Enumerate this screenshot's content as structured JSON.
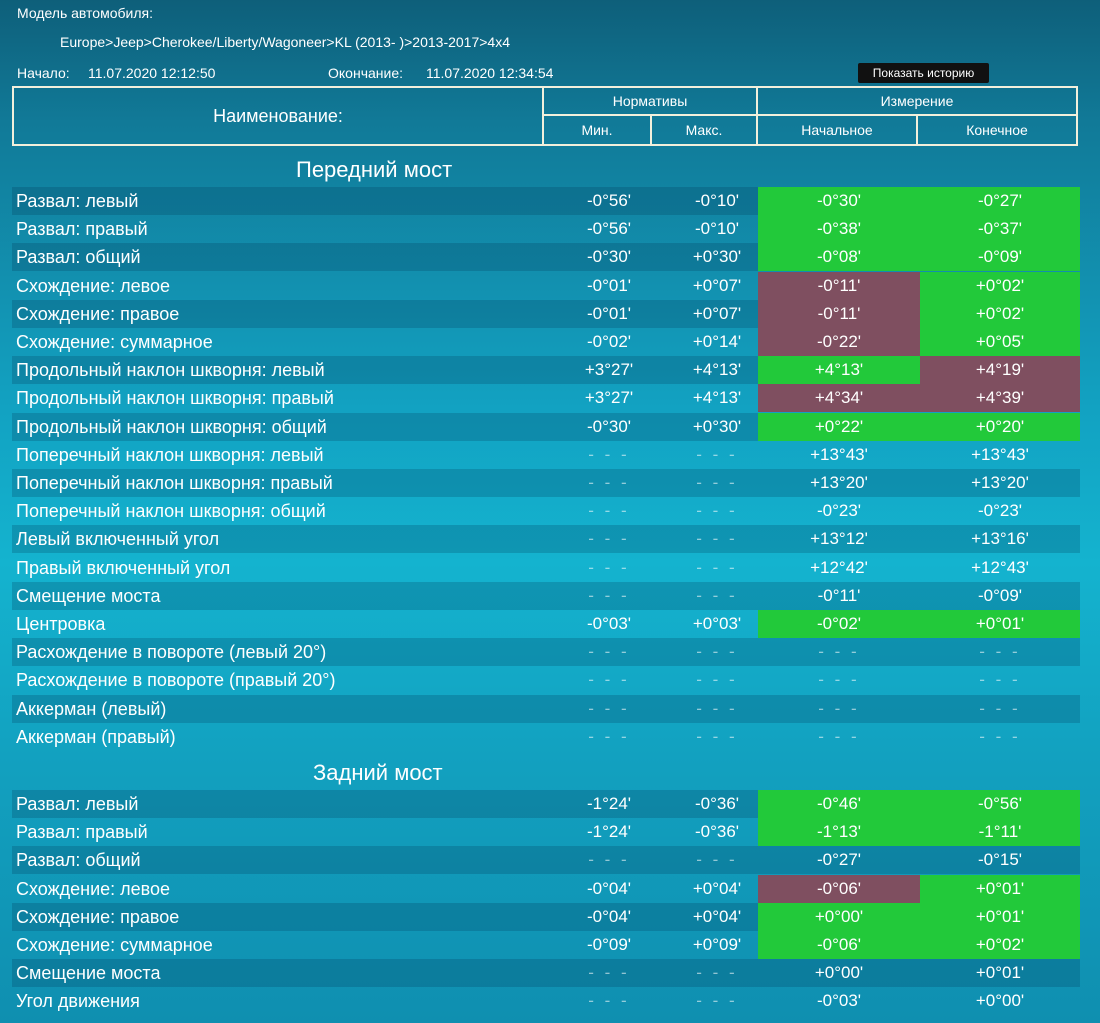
{
  "header": {
    "model_label": "Модель автомобиля:",
    "model_path": "Europe>Jeep>Cherokee/Liberty/Wagoneer>KL (2013- )>2013-2017>4x4",
    "start_label": "Начало:",
    "start_value": "11.07.2020 12:12:50",
    "end_label": "Окончание:",
    "end_value": "11.07.2020 12:34:54",
    "history_button": "Показать историю"
  },
  "table_header": {
    "name": "Наименование:",
    "norms": "Нормативы",
    "measure": "Измерение",
    "min": "Мин.",
    "max": "Макс.",
    "initial": "Начальное",
    "final": "Конечное"
  },
  "colors": {
    "green": "#22c93a",
    "red": "#7f4f60",
    "background": "#12a2c2"
  },
  "front": {
    "title": "Передний мост",
    "rows": [
      {
        "name": "Развал: левый",
        "min": "-0°56'",
        "max": "-0°10'",
        "initial": "-0°30'",
        "final": "-0°27'",
        "ini_status": "ok",
        "fin_status": "ok"
      },
      {
        "name": "Развал: правый",
        "min": "-0°56'",
        "max": "-0°10'",
        "initial": "-0°38'",
        "final": "-0°37'",
        "ini_status": "ok",
        "fin_status": "ok"
      },
      {
        "name": "Развал: общий",
        "min": "-0°30'",
        "max": "+0°30'",
        "initial": "-0°08'",
        "final": "-0°09'",
        "ini_status": "ok",
        "fin_status": "ok"
      },
      {
        "name": "Схождение: левое",
        "min": "-0°01'",
        "max": "+0°07'",
        "initial": "-0°11'",
        "final": "+0°02'",
        "ini_status": "bad",
        "fin_status": "ok"
      },
      {
        "name": "Схождение: правое",
        "min": "-0°01'",
        "max": "+0°07'",
        "initial": "-0°11'",
        "final": "+0°02'",
        "ini_status": "bad",
        "fin_status": "ok"
      },
      {
        "name": "Схождение: суммарное",
        "min": "-0°02'",
        "max": "+0°14'",
        "initial": "-0°22'",
        "final": "+0°05'",
        "ini_status": "bad",
        "fin_status": "ok"
      },
      {
        "name": "Продольный наклон шкворня: левый",
        "min": "+3°27'",
        "max": "+4°13'",
        "initial": "+4°13'",
        "final": "+4°19'",
        "ini_status": "ok",
        "fin_status": "bad"
      },
      {
        "name": "Продольный наклон шкворня: правый",
        "min": "+3°27'",
        "max": "+4°13'",
        "initial": "+4°34'",
        "final": "+4°39'",
        "ini_status": "bad",
        "fin_status": "bad"
      },
      {
        "name": "Продольный наклон шкворня: общий",
        "min": "-0°30'",
        "max": "+0°30'",
        "initial": "+0°22'",
        "final": "+0°20'",
        "ini_status": "ok",
        "fin_status": "ok"
      },
      {
        "name": "Поперечный наклон шкворня: левый",
        "min": "- - -",
        "max": "- - -",
        "initial": "+13°43'",
        "final": "+13°43'",
        "ini_status": "none",
        "fin_status": "none"
      },
      {
        "name": "Поперечный наклон шкворня: правый",
        "min": "- - -",
        "max": "- - -",
        "initial": "+13°20'",
        "final": "+13°20'",
        "ini_status": "none",
        "fin_status": "none"
      },
      {
        "name": "Поперечный наклон шкворня: общий",
        "min": "- - -",
        "max": "- - -",
        "initial": "-0°23'",
        "final": "-0°23'",
        "ini_status": "none",
        "fin_status": "none"
      },
      {
        "name": "Левый включенный угол",
        "min": "- - -",
        "max": "- - -",
        "initial": "+13°12'",
        "final": "+13°16'",
        "ini_status": "none",
        "fin_status": "none"
      },
      {
        "name": "Правый включенный угол",
        "min": "- - -",
        "max": "- - -",
        "initial": "+12°42'",
        "final": "+12°43'",
        "ini_status": "none",
        "fin_status": "none"
      },
      {
        "name": "Смещение моста",
        "min": "- - -",
        "max": "- - -",
        "initial": "-0°11'",
        "final": "-0°09'",
        "ini_status": "none",
        "fin_status": "none"
      },
      {
        "name": "Центровка",
        "min": "-0°03'",
        "max": "+0°03'",
        "initial": "-0°02'",
        "final": "+0°01'",
        "ini_status": "ok",
        "fin_status": "ok"
      },
      {
        "name": "Расхождение в повороте (левый 20°)",
        "min": "- - -",
        "max": "- - -",
        "initial": "- - -",
        "final": "- - -",
        "ini_status": "none",
        "fin_status": "none"
      },
      {
        "name": "Расхождение в повороте (правый 20°)",
        "min": "- - -",
        "max": "- - -",
        "initial": "- - -",
        "final": "- - -",
        "ini_status": "none",
        "fin_status": "none"
      },
      {
        "name": "Аккерман (левый)",
        "min": "- - -",
        "max": "- - -",
        "initial": "- - -",
        "final": "- - -",
        "ini_status": "none",
        "fin_status": "none"
      },
      {
        "name": "Аккерман (правый)",
        "min": "- - -",
        "max": "- - -",
        "initial": "- - -",
        "final": "- - -",
        "ini_status": "none",
        "fin_status": "none"
      }
    ]
  },
  "rear": {
    "title": "Задний мост",
    "rows": [
      {
        "name": "Развал: левый",
        "min": "-1°24'",
        "max": "-0°36'",
        "initial": "-0°46'",
        "final": "-0°56'",
        "ini_status": "ok",
        "fin_status": "ok"
      },
      {
        "name": "Развал: правый",
        "min": "-1°24'",
        "max": "-0°36'",
        "initial": "-1°13'",
        "final": "-1°11'",
        "ini_status": "ok",
        "fin_status": "ok"
      },
      {
        "name": "Развал: общий",
        "min": "- - -",
        "max": "- - -",
        "initial": "-0°27'",
        "final": "-0°15'",
        "ini_status": "none",
        "fin_status": "none"
      },
      {
        "name": "Схождение: левое",
        "min": "-0°04'",
        "max": "+0°04'",
        "initial": "-0°06'",
        "final": "+0°01'",
        "ini_status": "bad",
        "fin_status": "ok"
      },
      {
        "name": "Схождение: правое",
        "min": "-0°04'",
        "max": "+0°04'",
        "initial": "+0°00'",
        "final": "+0°01'",
        "ini_status": "ok",
        "fin_status": "ok"
      },
      {
        "name": "Схождение: суммарное",
        "min": "-0°09'",
        "max": "+0°09'",
        "initial": "-0°06'",
        "final": "+0°02'",
        "ini_status": "ok",
        "fin_status": "ok"
      },
      {
        "name": "Смещение моста",
        "min": "- - -",
        "max": "- - -",
        "initial": "+0°00'",
        "final": "+0°01'",
        "ini_status": "none",
        "fin_status": "none"
      },
      {
        "name": "Угол движения",
        "min": "- - -",
        "max": "- - -",
        "initial": "-0°03'",
        "final": "+0°00'",
        "ini_status": "none",
        "fin_status": "none"
      }
    ]
  }
}
